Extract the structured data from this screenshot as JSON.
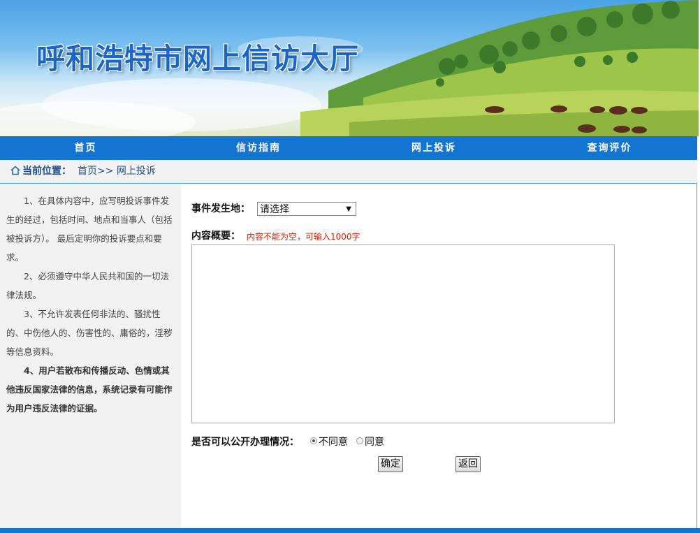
{
  "banner": {
    "title": "呼和浩特市网上信访大厅"
  },
  "nav": {
    "items": [
      {
        "label": "首页"
      },
      {
        "label": "信访指南"
      },
      {
        "label": "网上投诉"
      },
      {
        "label": "查询评价"
      }
    ]
  },
  "breadcrumb": {
    "label": "当前位置：",
    "path": "首页>> 网上投诉"
  },
  "notes": {
    "n1": "1、在具体内容中，应写明投诉事件发生的经过，包括时间、地点和当事人（包括被投诉方）。 最后定明你的投诉要点和要求。",
    "n2": "2、必须遵守中华人民共和国的一切法律法规。",
    "n3": "3、不允许发表任何非法的、骚扰性的、中伤他人的、伤害性的、庸俗的，淫秽等信息资料。",
    "n4": "4、用户若散布和传播反动、色情或其他违反国家法律的信息，系统记录有可能作为用户违反法律的证据。"
  },
  "form": {
    "location_label": "事件发生地：",
    "location_value": "请选择",
    "summary_label": "内容概要：",
    "summary_hint": "内容不能为空，可输入1000字",
    "summary_value": "",
    "public_label": "是否可以公开办理情况：",
    "public_options": [
      {
        "label": "不同意",
        "selected": true
      },
      {
        "label": "同意",
        "selected": false
      }
    ],
    "confirm_label": "确定",
    "back_label": "返回"
  },
  "colors": {
    "nav": "#1474d2",
    "hint": "#cc2200",
    "frame_border": "#4a9fd8"
  }
}
